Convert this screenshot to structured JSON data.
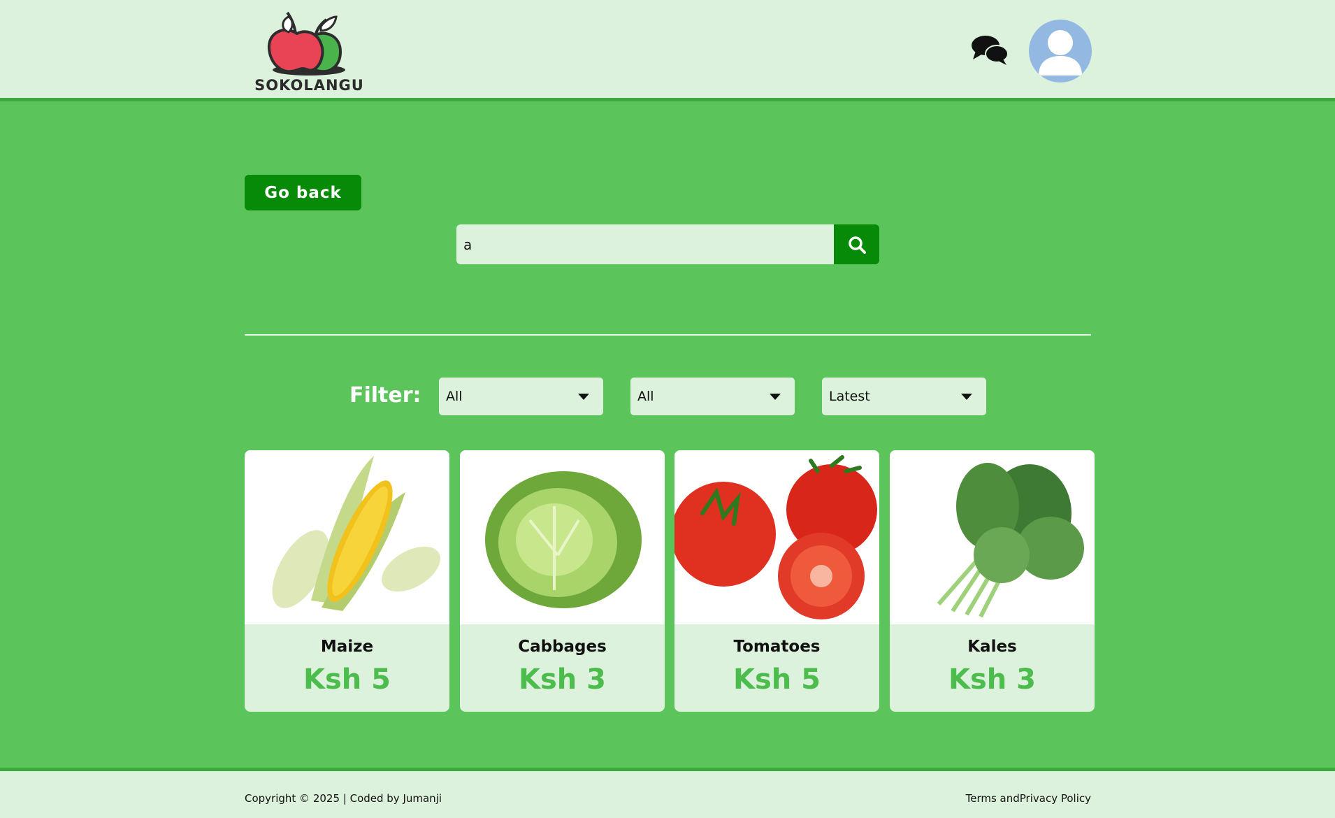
{
  "header": {
    "logo_text": "SOKOLANGU",
    "chat_icon": "chat-bubbles-icon",
    "avatar_icon": "user-avatar-icon"
  },
  "main": {
    "back_label": "Go back",
    "search": {
      "value": "a",
      "icon": "search-icon"
    },
    "filter": {
      "label": "Filter:",
      "selects": [
        {
          "value": "All"
        },
        {
          "value": "All"
        },
        {
          "value": "Latest"
        }
      ]
    },
    "products": [
      {
        "name": "Maize",
        "price": "Ksh 5",
        "image": "maize-image"
      },
      {
        "name": "Cabbages",
        "price": "Ksh 3",
        "image": "cabbage-image"
      },
      {
        "name": "Tomatoes",
        "price": "Ksh 5",
        "image": "tomatoes-image"
      },
      {
        "name": "Kales",
        "price": "Ksh 3",
        "image": "kales-image"
      }
    ]
  },
  "footer": {
    "copyright": "Copyright © 2025 | Coded by Jumanji",
    "terms": "Terms andPrivacy Policy"
  },
  "colors": {
    "main_bg": "#5bc45b",
    "header_bg": "#dcf2dc",
    "button_green": "#078a07",
    "price_green": "#4cbd4c"
  }
}
